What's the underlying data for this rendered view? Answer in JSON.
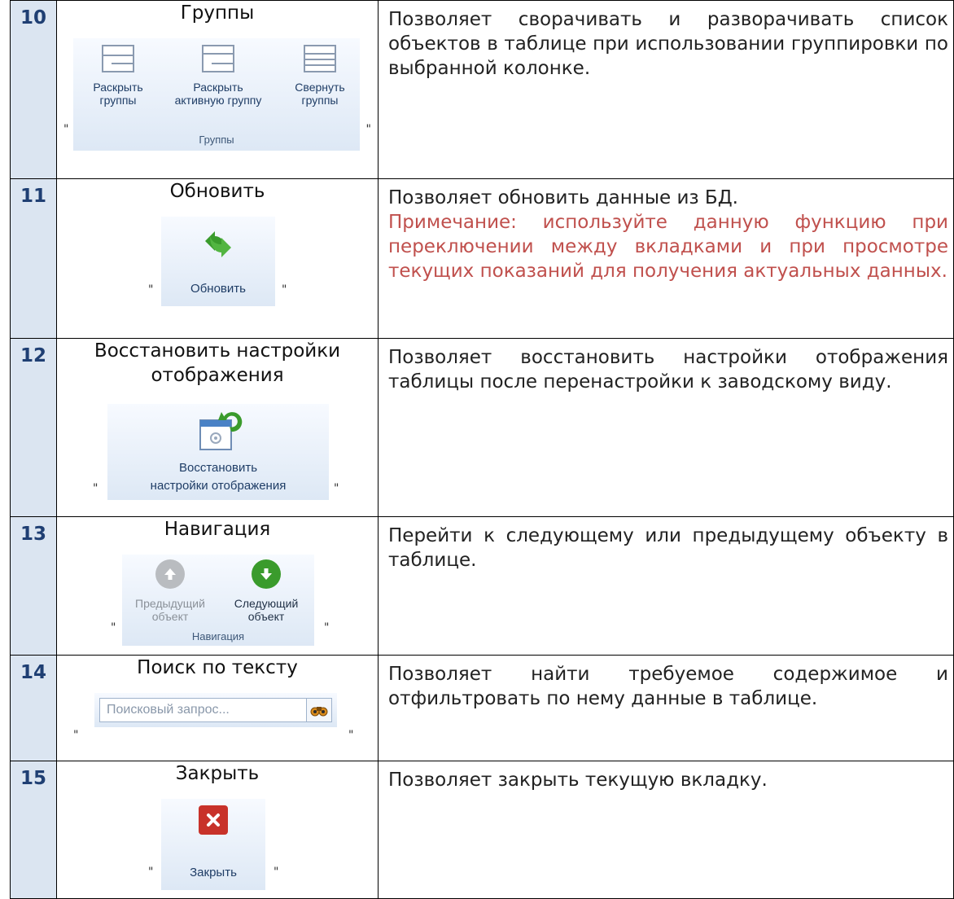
{
  "rows": [
    {
      "num": "10",
      "title": "Группы",
      "desc": "Позволяет сворачивать и разворачивать список объектов в таблице при использовании группировки по выбранной колонке.",
      "widget": {
        "buttons": [
          {
            "label": "Раскрыть группы"
          },
          {
            "label": "Раскрыть активную группу"
          },
          {
            "label": "Свернуть группы"
          }
        ],
        "group_label": "Группы",
        "icons": [
          "group-expand-icon",
          "group-expand-active-icon",
          "group-collapse-icon"
        ]
      }
    },
    {
      "num": "11",
      "title": "Обновить",
      "desc": "Позволяет обновить данные из БД.",
      "note": "Примечание: используйте данную функцию при переключении между вкладками и при просмотре текущих показаний для получения актуальных данных.",
      "widget": {
        "label": "Обновить",
        "icon": "refresh-icon",
        "icon_color": "#3a9b2c"
      }
    },
    {
      "num": "12",
      "title": "Восстановить настройки отображения",
      "desc": "Позволяет восстановить настройки отображения таблицы после перенастройки к заводскому виду.",
      "widget": {
        "label_line1": "Восстановить",
        "label_line2": "настройки отображения",
        "icon": "restore-view-settings-icon"
      }
    },
    {
      "num": "13",
      "title": "Навигация",
      "desc": "Перейти к следующему или предыдущему объекту в таблице.",
      "widget": {
        "prev_label_1": "Предыдущий",
        "prev_label_2": "объект",
        "next_label_1": "Следующий",
        "next_label_2": "объект",
        "group_label": "Навигация",
        "prev_color": "#b9bcc0",
        "next_color": "#3a9b2c"
      }
    },
    {
      "num": "14",
      "title": "Поиск по тексту",
      "desc": "Позволяет найти требуемое содержимое и отфильтровать по нему данные в таблице.",
      "widget": {
        "placeholder": "Поисковый запрос...",
        "icon": "binoculars-icon"
      }
    },
    {
      "num": "15",
      "title": "Закрыть",
      "desc": "Позволяет закрыть текущую вкладку.",
      "widget": {
        "label": "Закрыть",
        "icon": "close-icon",
        "icon_color": "#c8322a"
      }
    }
  ],
  "colors": {
    "note": "#c0504d",
    "num_bg": "#dbe5f1",
    "num_text": "#1f3f73"
  },
  "quote": "\""
}
